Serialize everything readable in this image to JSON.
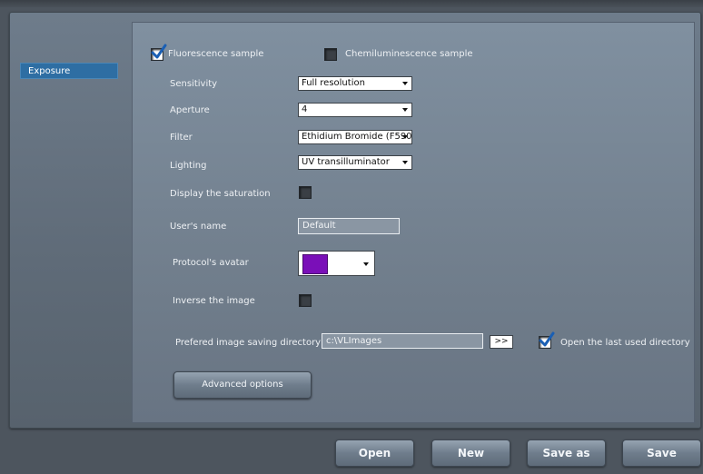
{
  "sidebar": {
    "items": [
      {
        "label": "Exposure",
        "selected": true
      }
    ]
  },
  "sample_type": {
    "fluorescence": {
      "label": "Fluorescence sample",
      "checked": true
    },
    "chemiluminescence": {
      "label": "Chemiluminescence sample",
      "checked": false
    }
  },
  "form": {
    "sensitivity": {
      "label": "Sensitivity",
      "value": "Full resolution"
    },
    "aperture": {
      "label": "Aperture",
      "value": "4"
    },
    "filter": {
      "label": "Filter",
      "value": "Ethidium Bromide (F590"
    },
    "lighting": {
      "label": "Lighting",
      "value": "UV transilluminator"
    },
    "display_saturation": {
      "label": "Display the saturation",
      "checked": false
    },
    "users_name": {
      "label": "User's name",
      "value": "Default"
    },
    "protocol_avatar": {
      "label": "Protocol's avatar",
      "color": "#7a0fb8"
    },
    "inverse_image": {
      "label": "Inverse the image",
      "checked": false
    },
    "saving_directory": {
      "label": "Prefered image saving directory",
      "value": "c:\\VLImages",
      "browse_label": ">>"
    },
    "open_last_dir": {
      "label": "Open the last used directory",
      "checked": true
    }
  },
  "buttons": {
    "advanced": "Advanced options",
    "open": "Open",
    "new": "New",
    "save_as": "Save as",
    "save": "Save"
  },
  "colors": {
    "selection": "#2e6ea3",
    "check": "#1a5fb4",
    "avatar": "#7a0fb8"
  }
}
